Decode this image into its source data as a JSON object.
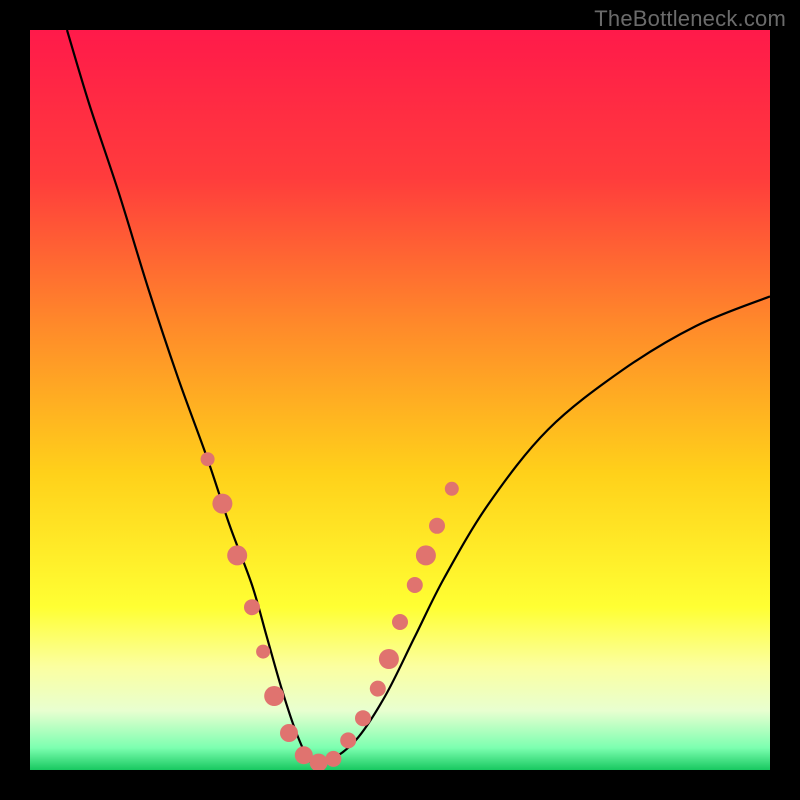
{
  "watermark": "TheBottleneck.com",
  "chart_data": {
    "type": "line",
    "title": "",
    "xlabel": "",
    "ylabel": "",
    "xlim": [
      0,
      100
    ],
    "ylim": [
      0,
      100
    ],
    "gradient_stops": [
      {
        "offset": 0.0,
        "color": "#ff1a4a"
      },
      {
        "offset": 0.2,
        "color": "#ff3c3c"
      },
      {
        "offset": 0.4,
        "color": "#ff8a2a"
      },
      {
        "offset": 0.6,
        "color": "#ffd11a"
      },
      {
        "offset": 0.78,
        "color": "#ffff33"
      },
      {
        "offset": 0.86,
        "color": "#fbffa0"
      },
      {
        "offset": 0.92,
        "color": "#e8ffd0"
      },
      {
        "offset": 0.97,
        "color": "#7cffb0"
      },
      {
        "offset": 1.0,
        "color": "#18c860"
      }
    ],
    "series": [
      {
        "name": "bottleneck-curve",
        "x": [
          5,
          8,
          12,
          16,
          20,
          24,
          27,
          30,
          32,
          34,
          36,
          38,
          40,
          44,
          48,
          52,
          56,
          62,
          70,
          80,
          90,
          100
        ],
        "y": [
          100,
          90,
          78,
          65,
          53,
          42,
          33,
          25,
          18,
          11,
          5,
          1,
          1,
          4,
          10,
          18,
          26,
          36,
          46,
          54,
          60,
          64
        ]
      }
    ],
    "markers": {
      "name": "highlight-points",
      "color": "#e0736f",
      "points": [
        {
          "x": 24,
          "y": 42,
          "r": 7
        },
        {
          "x": 26,
          "y": 36,
          "r": 10
        },
        {
          "x": 28,
          "y": 29,
          "r": 10
        },
        {
          "x": 30,
          "y": 22,
          "r": 8
        },
        {
          "x": 31.5,
          "y": 16,
          "r": 7
        },
        {
          "x": 33,
          "y": 10,
          "r": 10
        },
        {
          "x": 35,
          "y": 5,
          "r": 9
        },
        {
          "x": 37,
          "y": 2,
          "r": 9
        },
        {
          "x": 39,
          "y": 1,
          "r": 9
        },
        {
          "x": 41,
          "y": 1.5,
          "r": 8
        },
        {
          "x": 43,
          "y": 4,
          "r": 8
        },
        {
          "x": 45,
          "y": 7,
          "r": 8
        },
        {
          "x": 47,
          "y": 11,
          "r": 8
        },
        {
          "x": 48.5,
          "y": 15,
          "r": 10
        },
        {
          "x": 50,
          "y": 20,
          "r": 8
        },
        {
          "x": 52,
          "y": 25,
          "r": 8
        },
        {
          "x": 53.5,
          "y": 29,
          "r": 10
        },
        {
          "x": 55,
          "y": 33,
          "r": 8
        },
        {
          "x": 57,
          "y": 38,
          "r": 7
        }
      ]
    }
  }
}
